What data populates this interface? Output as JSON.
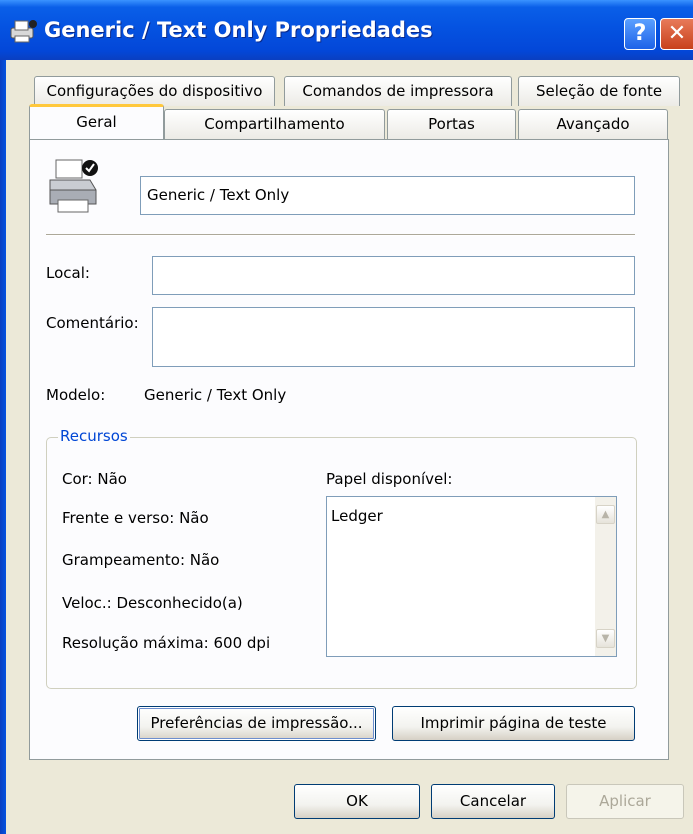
{
  "window": {
    "title": "Generic / Text Only Propriedades",
    "help_glyph": "?",
    "close_glyph": "✕"
  },
  "tabs_row1": [
    "Configurações do dispositivo",
    "Comandos de impressora",
    "Seleção de fonte"
  ],
  "tabs_row2": [
    "Geral",
    "Compartilhamento",
    "Portas",
    "Avançado"
  ],
  "active_tab": "Geral",
  "general": {
    "printer_name": "Generic / Text Only",
    "local_label": "Local:",
    "local_value": "",
    "comment_label": "Comentário:",
    "comment_value": "",
    "model_label": "Modelo:",
    "model_value": "Generic / Text Only"
  },
  "resources": {
    "title": "Recursos",
    "color": "Cor: Não",
    "duplex": "Frente e verso: Não",
    "staple": "Grampeamento: Não",
    "speed": "Veloc.: Desconhecido(a)",
    "resolution": "Resolução máxima: 600 dpi",
    "paper_label": "Papel disponível:",
    "paper_items": [
      "Ledger"
    ]
  },
  "buttons": {
    "preferences": "Preferências de impressão...",
    "test_page": "Imprimir página de teste",
    "ok": "OK",
    "cancel": "Cancelar",
    "apply": "Aplicar"
  },
  "colors": {
    "titlebar": "#0553E1",
    "dialog_bg": "#ECE9D8",
    "group_title": "#0046D5",
    "active_tab_accent": "#FFC83C"
  }
}
